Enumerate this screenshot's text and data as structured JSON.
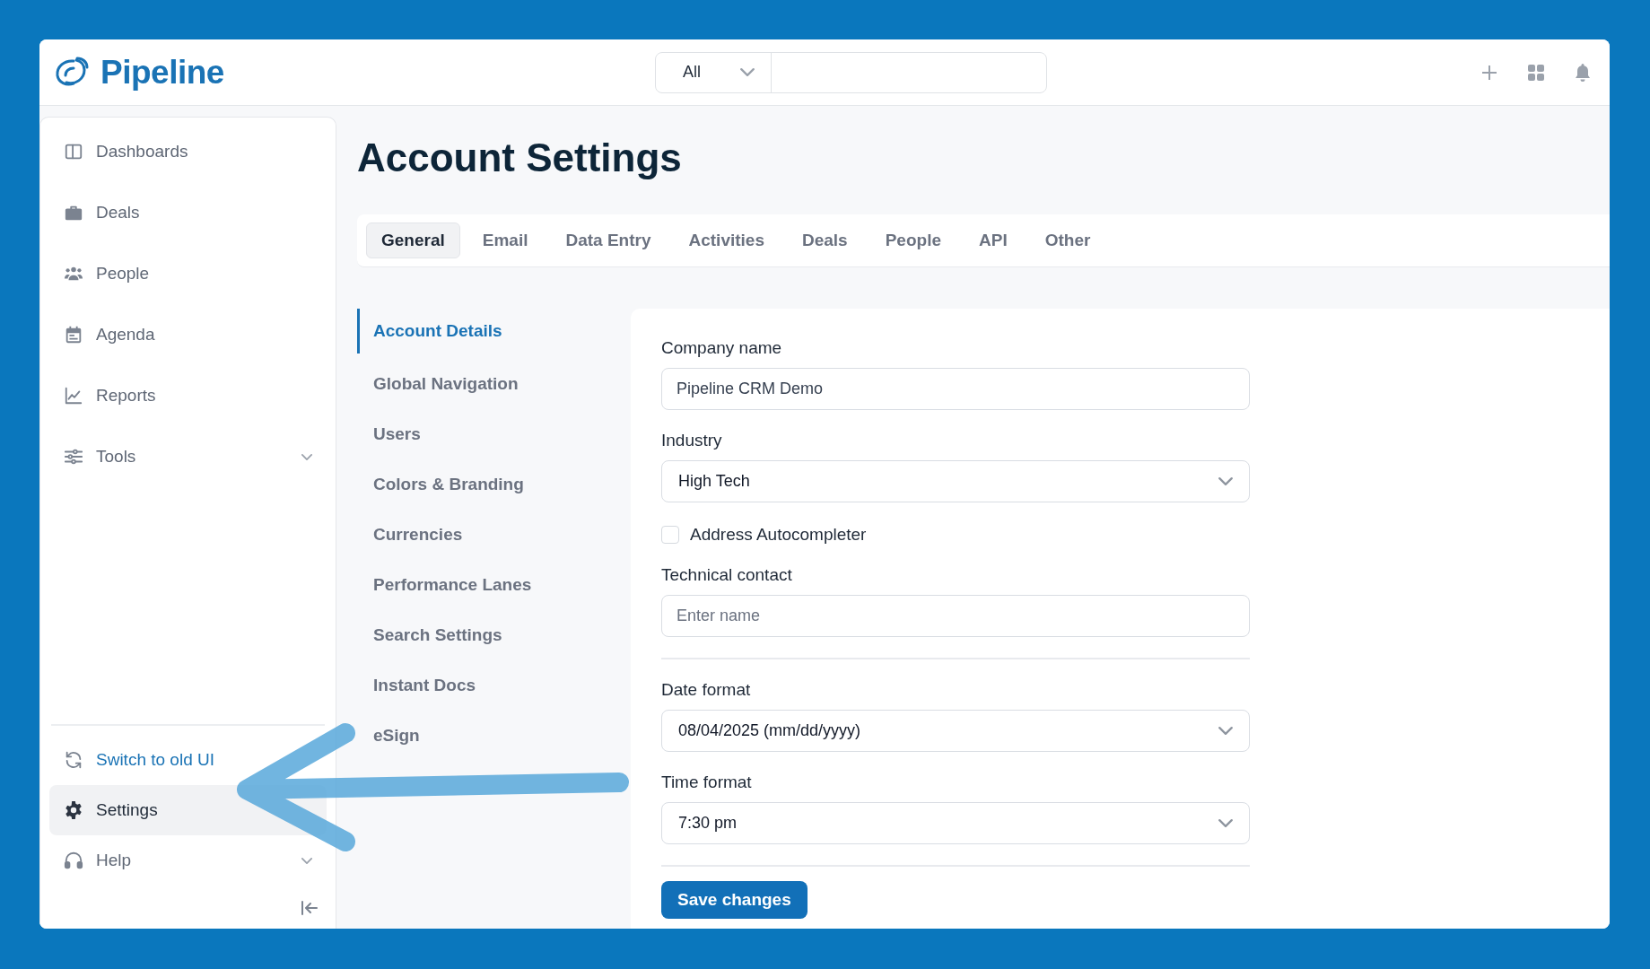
{
  "header": {
    "brand": "Pipeline",
    "search": {
      "scope": "All"
    }
  },
  "sidebar": {
    "items": [
      {
        "label": "Dashboards",
        "has_submenu": false
      },
      {
        "label": "Deals",
        "has_submenu": false
      },
      {
        "label": "People",
        "has_submenu": false
      },
      {
        "label": "Agenda",
        "has_submenu": false
      },
      {
        "label": "Reports",
        "has_submenu": false
      },
      {
        "label": "Tools",
        "has_submenu": true
      }
    ],
    "footer_items": [
      {
        "label": "Switch to old UI",
        "kind": "link",
        "selected": false,
        "has_submenu": false
      },
      {
        "label": "Settings",
        "kind": "item",
        "selected": true,
        "has_submenu": false
      },
      {
        "label": "Help",
        "kind": "item",
        "selected": false,
        "has_submenu": true
      }
    ]
  },
  "page": {
    "title": "Account Settings",
    "tabs": [
      {
        "label": "General",
        "selected": true
      },
      {
        "label": "Email",
        "selected": false
      },
      {
        "label": "Data Entry",
        "selected": false
      },
      {
        "label": "Activities",
        "selected": false
      },
      {
        "label": "Deals",
        "selected": false
      },
      {
        "label": "People",
        "selected": false
      },
      {
        "label": "API",
        "selected": false
      },
      {
        "label": "Other",
        "selected": false
      }
    ],
    "subnav": [
      {
        "label": "Account Details",
        "selected": true
      },
      {
        "label": "Global Navigation",
        "selected": false
      },
      {
        "label": "Users",
        "selected": false
      },
      {
        "label": "Colors & Branding",
        "selected": false
      },
      {
        "label": "Currencies",
        "selected": false
      },
      {
        "label": "Performance Lanes",
        "selected": false
      },
      {
        "label": "Search Settings",
        "selected": false
      },
      {
        "label": "Instant Docs",
        "selected": false
      },
      {
        "label": "eSign",
        "selected": false
      }
    ],
    "form": {
      "sections": [
        [
          {
            "kind": "text",
            "label": "Company name",
            "value": "Pipeline CRM Demo"
          },
          {
            "kind": "select",
            "label": "Industry",
            "value": "High Tech"
          },
          {
            "kind": "checkbox",
            "label": "Address Autocompleter",
            "checked": false
          },
          {
            "kind": "text",
            "label": "Technical contact",
            "placeholder": "Enter name"
          }
        ],
        [
          {
            "kind": "select",
            "label": "Date format",
            "value": "08/04/2025 (mm/dd/yyyy)"
          },
          {
            "kind": "select",
            "label": "Time format",
            "value": "7:30 pm"
          }
        ]
      ],
      "submit": "Save changes"
    }
  }
}
